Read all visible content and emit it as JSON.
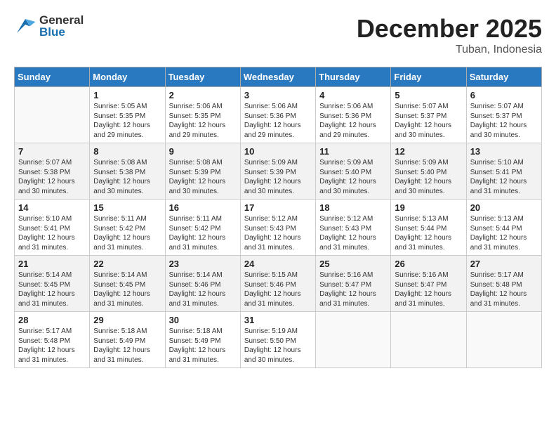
{
  "header": {
    "logo_general": "General",
    "logo_blue": "Blue",
    "title": "December 2025",
    "location": "Tuban, Indonesia"
  },
  "weekdays": [
    "Sunday",
    "Monday",
    "Tuesday",
    "Wednesday",
    "Thursday",
    "Friday",
    "Saturday"
  ],
  "weeks": [
    [
      {
        "day": "",
        "sunrise": "",
        "sunset": "",
        "daylight": ""
      },
      {
        "day": "1",
        "sunrise": "Sunrise: 5:05 AM",
        "sunset": "Sunset: 5:35 PM",
        "daylight": "Daylight: 12 hours and 29 minutes."
      },
      {
        "day": "2",
        "sunrise": "Sunrise: 5:06 AM",
        "sunset": "Sunset: 5:35 PM",
        "daylight": "Daylight: 12 hours and 29 minutes."
      },
      {
        "day": "3",
        "sunrise": "Sunrise: 5:06 AM",
        "sunset": "Sunset: 5:36 PM",
        "daylight": "Daylight: 12 hours and 29 minutes."
      },
      {
        "day": "4",
        "sunrise": "Sunrise: 5:06 AM",
        "sunset": "Sunset: 5:36 PM",
        "daylight": "Daylight: 12 hours and 29 minutes."
      },
      {
        "day": "5",
        "sunrise": "Sunrise: 5:07 AM",
        "sunset": "Sunset: 5:37 PM",
        "daylight": "Daylight: 12 hours and 30 minutes."
      },
      {
        "day": "6",
        "sunrise": "Sunrise: 5:07 AM",
        "sunset": "Sunset: 5:37 PM",
        "daylight": "Daylight: 12 hours and 30 minutes."
      }
    ],
    [
      {
        "day": "7",
        "sunrise": "Sunrise: 5:07 AM",
        "sunset": "Sunset: 5:38 PM",
        "daylight": "Daylight: 12 hours and 30 minutes."
      },
      {
        "day": "8",
        "sunrise": "Sunrise: 5:08 AM",
        "sunset": "Sunset: 5:38 PM",
        "daylight": "Daylight: 12 hours and 30 minutes."
      },
      {
        "day": "9",
        "sunrise": "Sunrise: 5:08 AM",
        "sunset": "Sunset: 5:39 PM",
        "daylight": "Daylight: 12 hours and 30 minutes."
      },
      {
        "day": "10",
        "sunrise": "Sunrise: 5:09 AM",
        "sunset": "Sunset: 5:39 PM",
        "daylight": "Daylight: 12 hours and 30 minutes."
      },
      {
        "day": "11",
        "sunrise": "Sunrise: 5:09 AM",
        "sunset": "Sunset: 5:40 PM",
        "daylight": "Daylight: 12 hours and 30 minutes."
      },
      {
        "day": "12",
        "sunrise": "Sunrise: 5:09 AM",
        "sunset": "Sunset: 5:40 PM",
        "daylight": "Daylight: 12 hours and 30 minutes."
      },
      {
        "day": "13",
        "sunrise": "Sunrise: 5:10 AM",
        "sunset": "Sunset: 5:41 PM",
        "daylight": "Daylight: 12 hours and 31 minutes."
      }
    ],
    [
      {
        "day": "14",
        "sunrise": "Sunrise: 5:10 AM",
        "sunset": "Sunset: 5:41 PM",
        "daylight": "Daylight: 12 hours and 31 minutes."
      },
      {
        "day": "15",
        "sunrise": "Sunrise: 5:11 AM",
        "sunset": "Sunset: 5:42 PM",
        "daylight": "Daylight: 12 hours and 31 minutes."
      },
      {
        "day": "16",
        "sunrise": "Sunrise: 5:11 AM",
        "sunset": "Sunset: 5:42 PM",
        "daylight": "Daylight: 12 hours and 31 minutes."
      },
      {
        "day": "17",
        "sunrise": "Sunrise: 5:12 AM",
        "sunset": "Sunset: 5:43 PM",
        "daylight": "Daylight: 12 hours and 31 minutes."
      },
      {
        "day": "18",
        "sunrise": "Sunrise: 5:12 AM",
        "sunset": "Sunset: 5:43 PM",
        "daylight": "Daylight: 12 hours and 31 minutes."
      },
      {
        "day": "19",
        "sunrise": "Sunrise: 5:13 AM",
        "sunset": "Sunset: 5:44 PM",
        "daylight": "Daylight: 12 hours and 31 minutes."
      },
      {
        "day": "20",
        "sunrise": "Sunrise: 5:13 AM",
        "sunset": "Sunset: 5:44 PM",
        "daylight": "Daylight: 12 hours and 31 minutes."
      }
    ],
    [
      {
        "day": "21",
        "sunrise": "Sunrise: 5:14 AM",
        "sunset": "Sunset: 5:45 PM",
        "daylight": "Daylight: 12 hours and 31 minutes."
      },
      {
        "day": "22",
        "sunrise": "Sunrise: 5:14 AM",
        "sunset": "Sunset: 5:45 PM",
        "daylight": "Daylight: 12 hours and 31 minutes."
      },
      {
        "day": "23",
        "sunrise": "Sunrise: 5:14 AM",
        "sunset": "Sunset: 5:46 PM",
        "daylight": "Daylight: 12 hours and 31 minutes."
      },
      {
        "day": "24",
        "sunrise": "Sunrise: 5:15 AM",
        "sunset": "Sunset: 5:46 PM",
        "daylight": "Daylight: 12 hours and 31 minutes."
      },
      {
        "day": "25",
        "sunrise": "Sunrise: 5:16 AM",
        "sunset": "Sunset: 5:47 PM",
        "daylight": "Daylight: 12 hours and 31 minutes."
      },
      {
        "day": "26",
        "sunrise": "Sunrise: 5:16 AM",
        "sunset": "Sunset: 5:47 PM",
        "daylight": "Daylight: 12 hours and 31 minutes."
      },
      {
        "day": "27",
        "sunrise": "Sunrise: 5:17 AM",
        "sunset": "Sunset: 5:48 PM",
        "daylight": "Daylight: 12 hours and 31 minutes."
      }
    ],
    [
      {
        "day": "28",
        "sunrise": "Sunrise: 5:17 AM",
        "sunset": "Sunset: 5:48 PM",
        "daylight": "Daylight: 12 hours and 31 minutes."
      },
      {
        "day": "29",
        "sunrise": "Sunrise: 5:18 AM",
        "sunset": "Sunset: 5:49 PM",
        "daylight": "Daylight: 12 hours and 31 minutes."
      },
      {
        "day": "30",
        "sunrise": "Sunrise: 5:18 AM",
        "sunset": "Sunset: 5:49 PM",
        "daylight": "Daylight: 12 hours and 31 minutes."
      },
      {
        "day": "31",
        "sunrise": "Sunrise: 5:19 AM",
        "sunset": "Sunset: 5:50 PM",
        "daylight": "Daylight: 12 hours and 30 minutes."
      },
      {
        "day": "",
        "sunrise": "",
        "sunset": "",
        "daylight": ""
      },
      {
        "day": "",
        "sunrise": "",
        "sunset": "",
        "daylight": ""
      },
      {
        "day": "",
        "sunrise": "",
        "sunset": "",
        "daylight": ""
      }
    ]
  ]
}
